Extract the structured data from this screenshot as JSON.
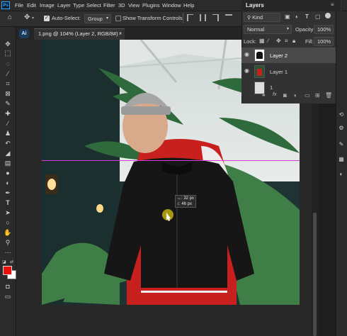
{
  "menu": [
    "File",
    "Edit",
    "Image",
    "Layer",
    "Type",
    "Select",
    "Filter",
    "3D",
    "View",
    "Plugins",
    "Window",
    "Help"
  ],
  "options": {
    "auto_select_label": "Auto-Select:",
    "auto_select_value": "Group",
    "show_transform_label": "Show Transform Controls"
  },
  "document": {
    "tab_title": "1.png @ 104% (Layer 2, RGB/8#) *"
  },
  "tooltip": {
    "line1": "↔: 32 px",
    "line2": "↕: 46 px"
  },
  "layers_panel": {
    "title": "Layers",
    "filter_value": "Kind",
    "blend_mode": "Normal",
    "opacity_label": "Opacity:",
    "opacity_value": "100%",
    "lock_label": "Lock:",
    "fill_label": "Fill:",
    "fill_value": "100%",
    "layers": [
      {
        "name": "Layer 2",
        "selected": true
      },
      {
        "name": "Layer 1",
        "selected": false
      },
      {
        "name": "1",
        "selected": false
      }
    ]
  },
  "colors": {
    "foreground": "#e8120c",
    "background": "#ffffff",
    "guide": "#d63cd6",
    "accent": "#31a8ff"
  }
}
